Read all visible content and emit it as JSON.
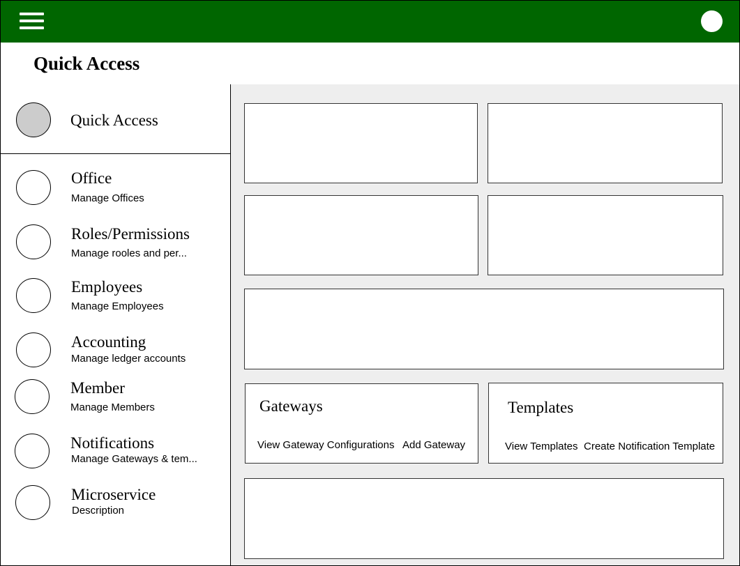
{
  "header": {
    "menu_icon": "hamburger-menu-icon",
    "user_icon": "user-avatar-icon",
    "background_color": "#006600"
  },
  "page": {
    "title": "Quick Access"
  },
  "sidebar": {
    "active_item": {
      "title": "Quick Access"
    },
    "items": [
      {
        "title": "Office",
        "subtitle": "Manage Offices"
      },
      {
        "title": "Roles/Permissions",
        "subtitle": "Manage rooles and per..."
      },
      {
        "title": "Employees",
        "subtitle": "Manage Employees"
      },
      {
        "title": "Accounting",
        "subtitle": "Manage ledger accounts"
      },
      {
        "title": "Member",
        "subtitle": "Manage Members"
      },
      {
        "title": "Notifications",
        "subtitle": "Manage Gateways & tem..."
      },
      {
        "title": "Microservice",
        "subtitle": "Description"
      }
    ]
  },
  "cards": {
    "gateways": {
      "title": "Gateways",
      "links": [
        "View Gateway Configurations",
        "Add Gateway"
      ]
    },
    "templates": {
      "title": "Templates",
      "links": [
        "View Templates",
        "Create Notification Template"
      ]
    }
  },
  "colors": {
    "content_background": "#eeeeee",
    "active_circle": "#cccccc"
  }
}
